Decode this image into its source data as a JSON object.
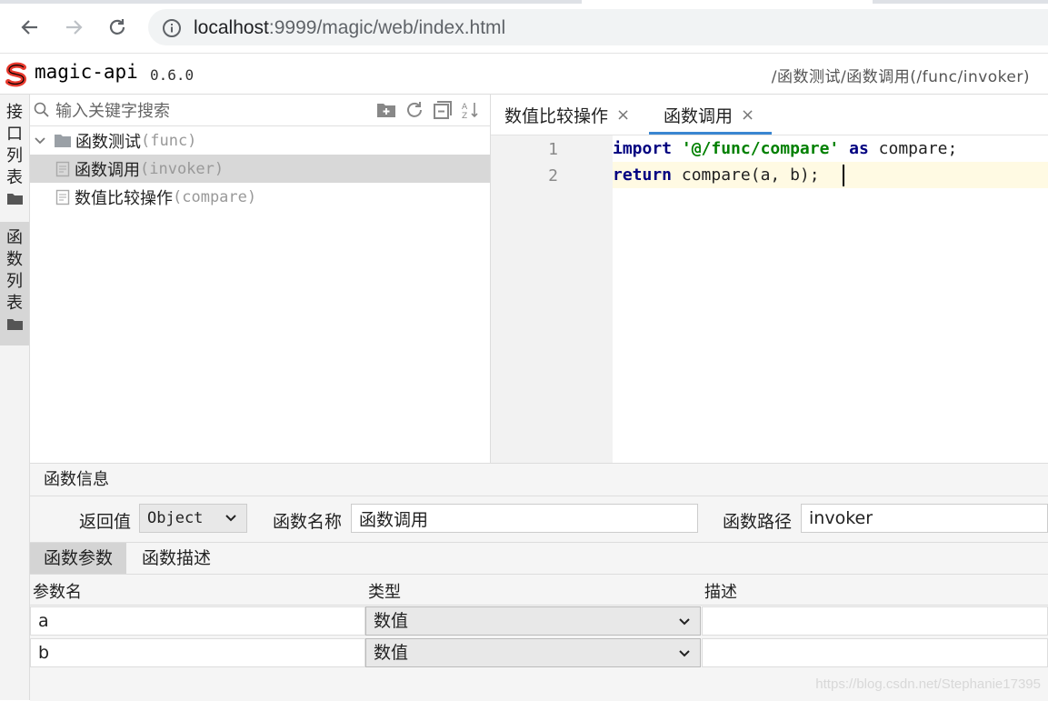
{
  "browser": {
    "url_host": "localhost",
    "url_rest": ":9999/magic/web/index.html"
  },
  "app": {
    "name": "magic-api",
    "version": "0.6.0",
    "breadcrumb": "/函数测试/函数调用(/func/invoker)",
    "logo_color": "#e8392e"
  },
  "rail": {
    "api_list": [
      "接",
      "口",
      "列",
      "表"
    ],
    "func_list": [
      "函",
      "数",
      "列",
      "表"
    ]
  },
  "tree": {
    "search_placeholder": "输入关键字搜索",
    "items": [
      {
        "label": "函数测试",
        "sub": "(func)"
      },
      {
        "label": "函数调用",
        "sub": "(invoker)"
      },
      {
        "label": "数值比较操作",
        "sub": "(compare)"
      }
    ]
  },
  "editor": {
    "tabs": [
      {
        "label": "数值比较操作",
        "close": "×"
      },
      {
        "label": "函数调用",
        "close": "×"
      }
    ],
    "line_numbers": [
      "1",
      "2"
    ],
    "line1": {
      "kw1": "import",
      "str": "'@/func/compare'",
      "kw2": "as",
      "rest": "compare;"
    },
    "line2": {
      "kw1": "return",
      "rest": "compare(a, b);"
    }
  },
  "info": {
    "title": "函数信息",
    "return_label": "返回值",
    "return_value": "Object",
    "name_label": "函数名称",
    "name_value": "函数调用",
    "path_label": "函数路径",
    "path_value": "invoker",
    "tabs": [
      "函数参数",
      "函数描述"
    ],
    "columns": [
      "参数名",
      "类型",
      "描述"
    ],
    "params": [
      {
        "name": "a",
        "type": "数值",
        "desc": ""
      },
      {
        "name": "b",
        "type": "数值",
        "desc": ""
      }
    ]
  },
  "watermark": "https://blog.csdn.net/Stephanie17395"
}
